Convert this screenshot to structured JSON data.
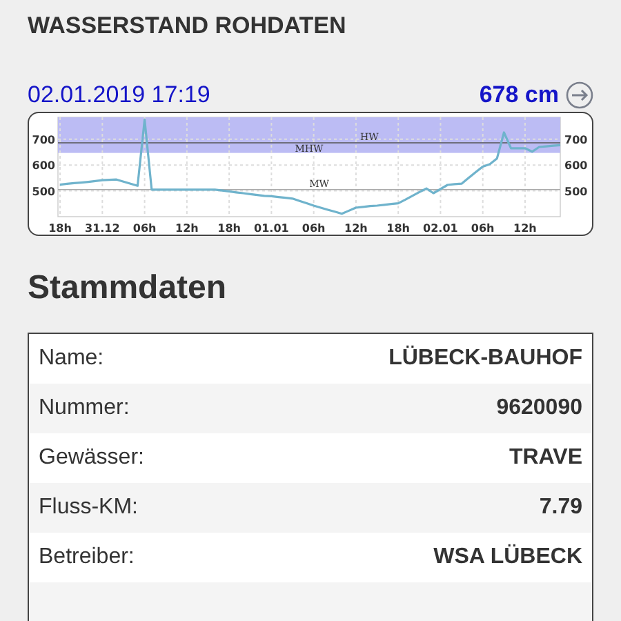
{
  "header": {
    "title": "WASSERSTAND ROHDATEN"
  },
  "current": {
    "timestamp": "02.01.2019 17:19",
    "level_text": "678 cm"
  },
  "chart_data": {
    "type": "line",
    "categories": [
      "18h",
      null,
      null,
      null,
      null,
      null,
      "31.12",
      null,
      null,
      null,
      null,
      null,
      "06h",
      null,
      null,
      null,
      null,
      null,
      "12h",
      null,
      null,
      null,
      null,
      null,
      "18h",
      null,
      null,
      null,
      null,
      null,
      "01.01",
      null,
      null,
      null,
      null,
      null,
      "06h",
      null,
      null,
      null,
      null,
      null,
      "12h",
      null,
      null,
      null,
      null,
      null,
      "18h",
      null,
      null,
      null,
      null,
      null,
      "02.01",
      null,
      null,
      null,
      null,
      null,
      "06h",
      null,
      null,
      null,
      null,
      null,
      "12h",
      null,
      null,
      null,
      null,
      null
    ],
    "series": [
      {
        "color": "#6fb3cc",
        "values": [
          524,
          527,
          530,
          532,
          535,
          538,
          541,
          543,
          544,
          536,
          528,
          520,
          776,
          505,
          505,
          505,
          505,
          505,
          505,
          505,
          505,
          505,
          505,
          501,
          498,
          494,
          491,
          487,
          484,
          481,
          479,
          476,
          473,
          470,
          461,
          452,
          443,
          435,
          427,
          419,
          411,
          423,
          435,
          438,
          441,
          443,
          446,
          449,
          452,
          466,
          481,
          495,
          509,
          491,
          507,
          523,
          526,
          528,
          550,
          572,
          594,
          603,
          625,
          726,
          665,
          665,
          665,
          652,
          670,
          672,
          675,
          677
        ]
      }
    ],
    "ylim": [
      400,
      785
    ],
    "yticks": [
      500,
      600,
      700
    ],
    "y2lim": [
      400,
      785
    ],
    "y2ticks": [
      500,
      600,
      700
    ],
    "grid": true,
    "ref_lines": [
      {
        "axis": "y",
        "value": 686,
        "label": "HW"
      },
      {
        "axis": "y",
        "value": 505,
        "label": "MW"
      }
    ],
    "bands": [
      {
        "axis": "y",
        "from": 647,
        "to": 785,
        "label": "MHW"
      }
    ]
  },
  "section": {
    "title": "Stammdaten"
  },
  "rows": [
    {
      "label": "Name:",
      "value": "LÜBECK-BAUHOF"
    },
    {
      "label": "Nummer:",
      "value": "9620090"
    },
    {
      "label": "Gewässer:",
      "value": "TRAVE"
    },
    {
      "label": "Fluss-KM:",
      "value": "7.79"
    },
    {
      "label": "Betreiber:",
      "value": "WSA LÜBECK"
    }
  ]
}
